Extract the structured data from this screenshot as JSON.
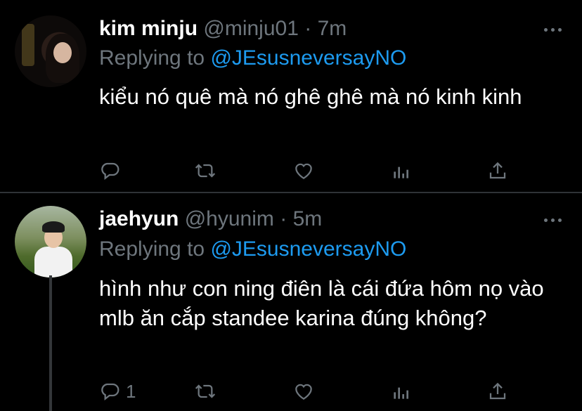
{
  "tweets": [
    {
      "name": "kim minju",
      "handle": "@minju01",
      "dot": "·",
      "time": "7m",
      "replying_prefix": "Replying to ",
      "replying_to": "@JEsusneversayNO",
      "text": "kiểu nó quê mà nó ghê ghê mà nó kinh kinh",
      "reply_count": "",
      "icons": [
        "reply-icon",
        "retweet-icon",
        "like-icon",
        "analytics-icon",
        "share-icon",
        "more-icon"
      ]
    },
    {
      "name": "jaehyun",
      "handle": "@hyunim",
      "dot": "·",
      "time": "5m",
      "replying_prefix": "Replying to ",
      "replying_to": "@JEsusneversayNO",
      "text": "hình như con ning điên là cái đứa hôm nọ vào mlb ăn cắp standee karina đúng không?",
      "reply_count": "1",
      "icons": [
        "reply-icon",
        "retweet-icon",
        "like-icon",
        "analytics-icon",
        "share-icon",
        "more-icon"
      ]
    }
  ],
  "colors": {
    "background": "#000000",
    "primary_text": "#ffffff",
    "secondary_text": "#6e767d",
    "mention": "#1d9bf0",
    "divider": "#2f3336"
  }
}
